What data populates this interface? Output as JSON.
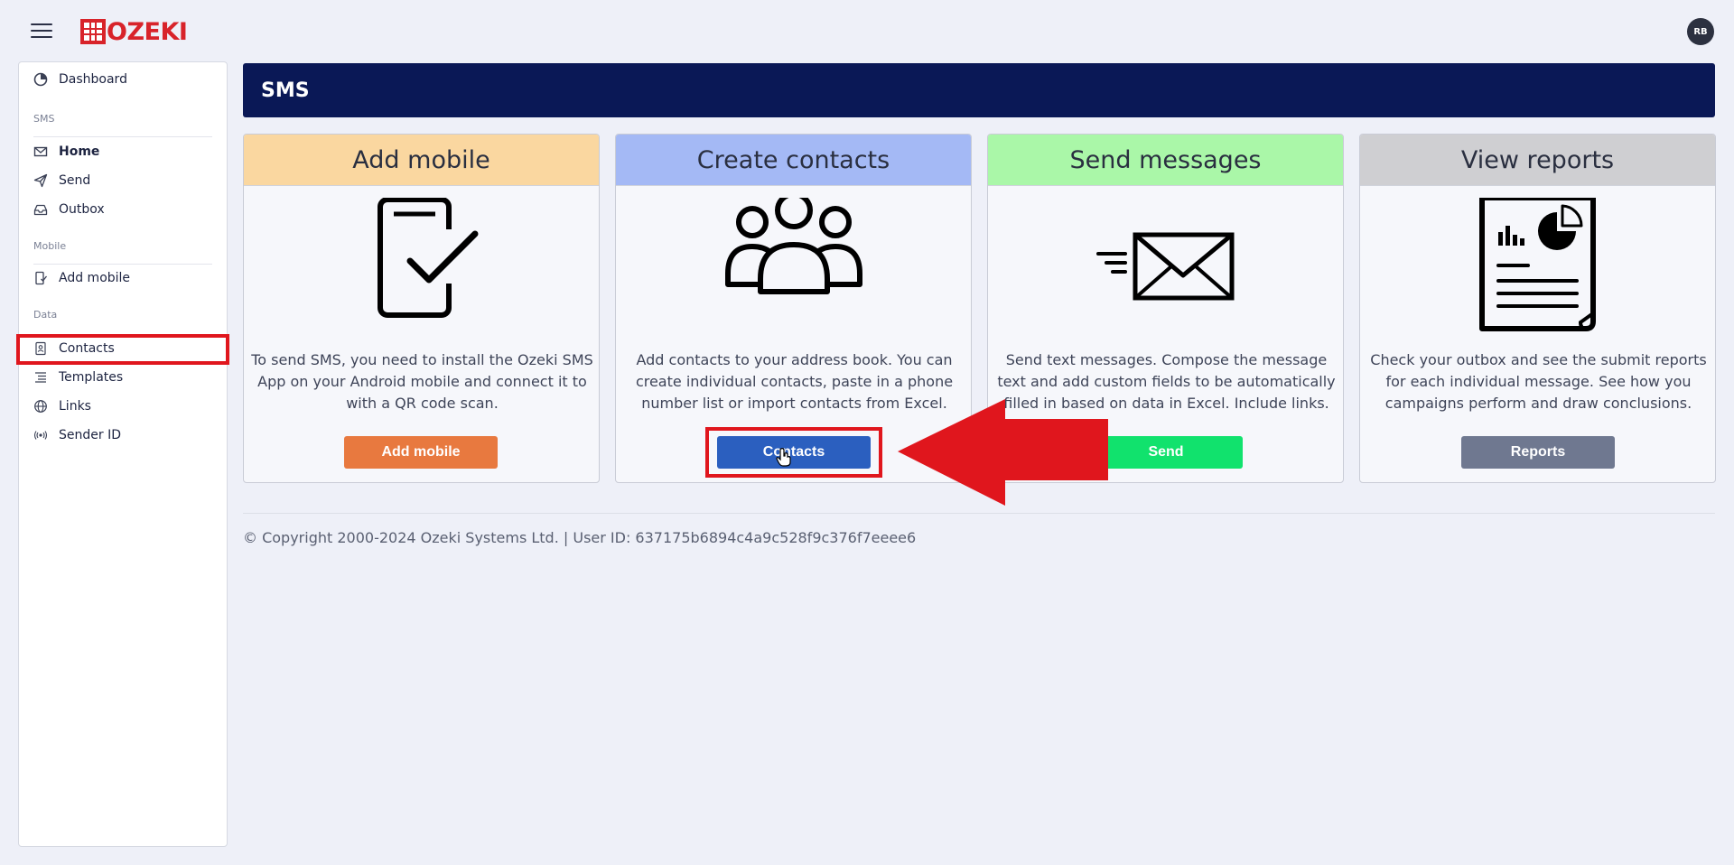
{
  "header": {
    "brand": "OZEKI",
    "avatar_initials": "RB"
  },
  "sidebar": {
    "dashboard": "Dashboard",
    "sections": {
      "sms": "SMS",
      "mobile": "Mobile",
      "data": "Data"
    },
    "items": {
      "home": "Home",
      "send": "Send",
      "outbox": "Outbox",
      "add_mobile": "Add mobile",
      "contacts": "Contacts",
      "templates": "Templates",
      "links": "Links",
      "sender_id": "Sender ID"
    }
  },
  "main": {
    "title": "SMS",
    "cards": [
      {
        "title": "Add mobile",
        "description": "To send SMS, you need to install the Ozeki SMS App on your Android mobile and connect it to with a QR code scan.",
        "button": "Add mobile",
        "header_color": "#fad7a0",
        "button_color": "#e8793f",
        "icon": "phone-check-icon"
      },
      {
        "title": "Create contacts",
        "description": "Add contacts to your address book. You can create individual contacts, paste in a phone number list or import contacts from Excel.",
        "button": "Contacts",
        "header_color": "#a4b9f5",
        "button_color": "#2b5fbf",
        "icon": "people-group-icon"
      },
      {
        "title": "Send messages",
        "description": "Send text messages. Compose the message text and add custom fields to be automatically filled in based on data in Excel. Include links.",
        "button": "Send",
        "header_color": "#aaf7a8",
        "button_color": "#11e26d",
        "icon": "envelope-fast-icon"
      },
      {
        "title": "View reports",
        "description": "Check your outbox and see the submit reports for each individual message. See how you campaigns perform and draw conclusions.",
        "button": "Reports",
        "header_color": "#cfcfd2",
        "button_color": "#6f7890",
        "icon": "report-document-icon"
      }
    ],
    "copyright": "© Copyright 2000-2024 Ozeki Systems Ltd. | User ID: 637175b6894c4a9c528f9c376f7eeee6"
  },
  "annotations": {
    "arrow_color": "#e0161d"
  }
}
